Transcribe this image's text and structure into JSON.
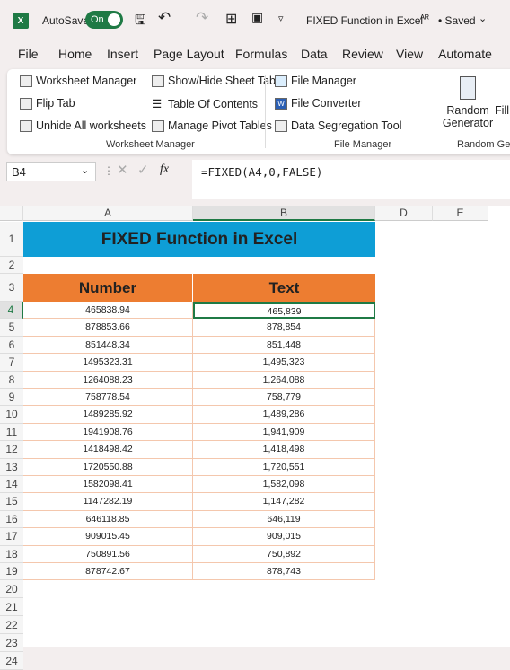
{
  "titlebar": {
    "autosave": "AutoSave",
    "toggle": "On",
    "doc_title": "FIXED Function in Excel",
    "status": "• Saved"
  },
  "menu": [
    "File",
    "Home",
    "Insert",
    "Page Layout",
    "Formulas",
    "Data",
    "Review",
    "View",
    "Automate"
  ],
  "ribbon": {
    "worksheet_manager": {
      "items": [
        "Worksheet Manager",
        "Flip Tab",
        "Unhide All worksheets",
        "Show/Hide Sheet Tabs",
        "Table Of Contents",
        "Manage Pivot Tables"
      ],
      "label": "Worksheet Manager"
    },
    "file_manager": {
      "items": [
        "File Manager",
        "File Converter",
        "Data Segregation Tool"
      ],
      "label": "File Manager"
    },
    "random": {
      "button1": "Random",
      "button1b": "Generator",
      "button2": "Fill",
      "label": "Random Gen"
    }
  },
  "formula_bar": {
    "name_box": "B4",
    "fx": "fx",
    "formula": "=FIXED(A4,0,FALSE)"
  },
  "columns": [
    "A",
    "B",
    "D",
    "E"
  ],
  "sheet": {
    "title": "FIXED Function in Excel",
    "headers": [
      "Number",
      "Text"
    ],
    "rows": [
      [
        "465838.94",
        "465,839"
      ],
      [
        "878853.66",
        "878,854"
      ],
      [
        "851448.34",
        "851,448"
      ],
      [
        "1495323.31",
        "1,495,323"
      ],
      [
        "1264088.23",
        "1,264,088"
      ],
      [
        "758778.54",
        "758,779"
      ],
      [
        "1489285.92",
        "1,489,286"
      ],
      [
        "1941908.76",
        "1,941,909"
      ],
      [
        "1418498.42",
        "1,418,498"
      ],
      [
        "1720550.88",
        "1,720,551"
      ],
      [
        "1582098.41",
        "1,582,098"
      ],
      [
        "1147282.19",
        "1,147,282"
      ],
      [
        "646118.85",
        "646,119"
      ],
      [
        "909015.45",
        "909,015"
      ],
      [
        "750891.56",
        "750,892"
      ],
      [
        "878742.67",
        "878,743"
      ]
    ],
    "title_color": "#0e9ed6",
    "header_color": "#ed7d31",
    "selected_cell": "B4"
  }
}
